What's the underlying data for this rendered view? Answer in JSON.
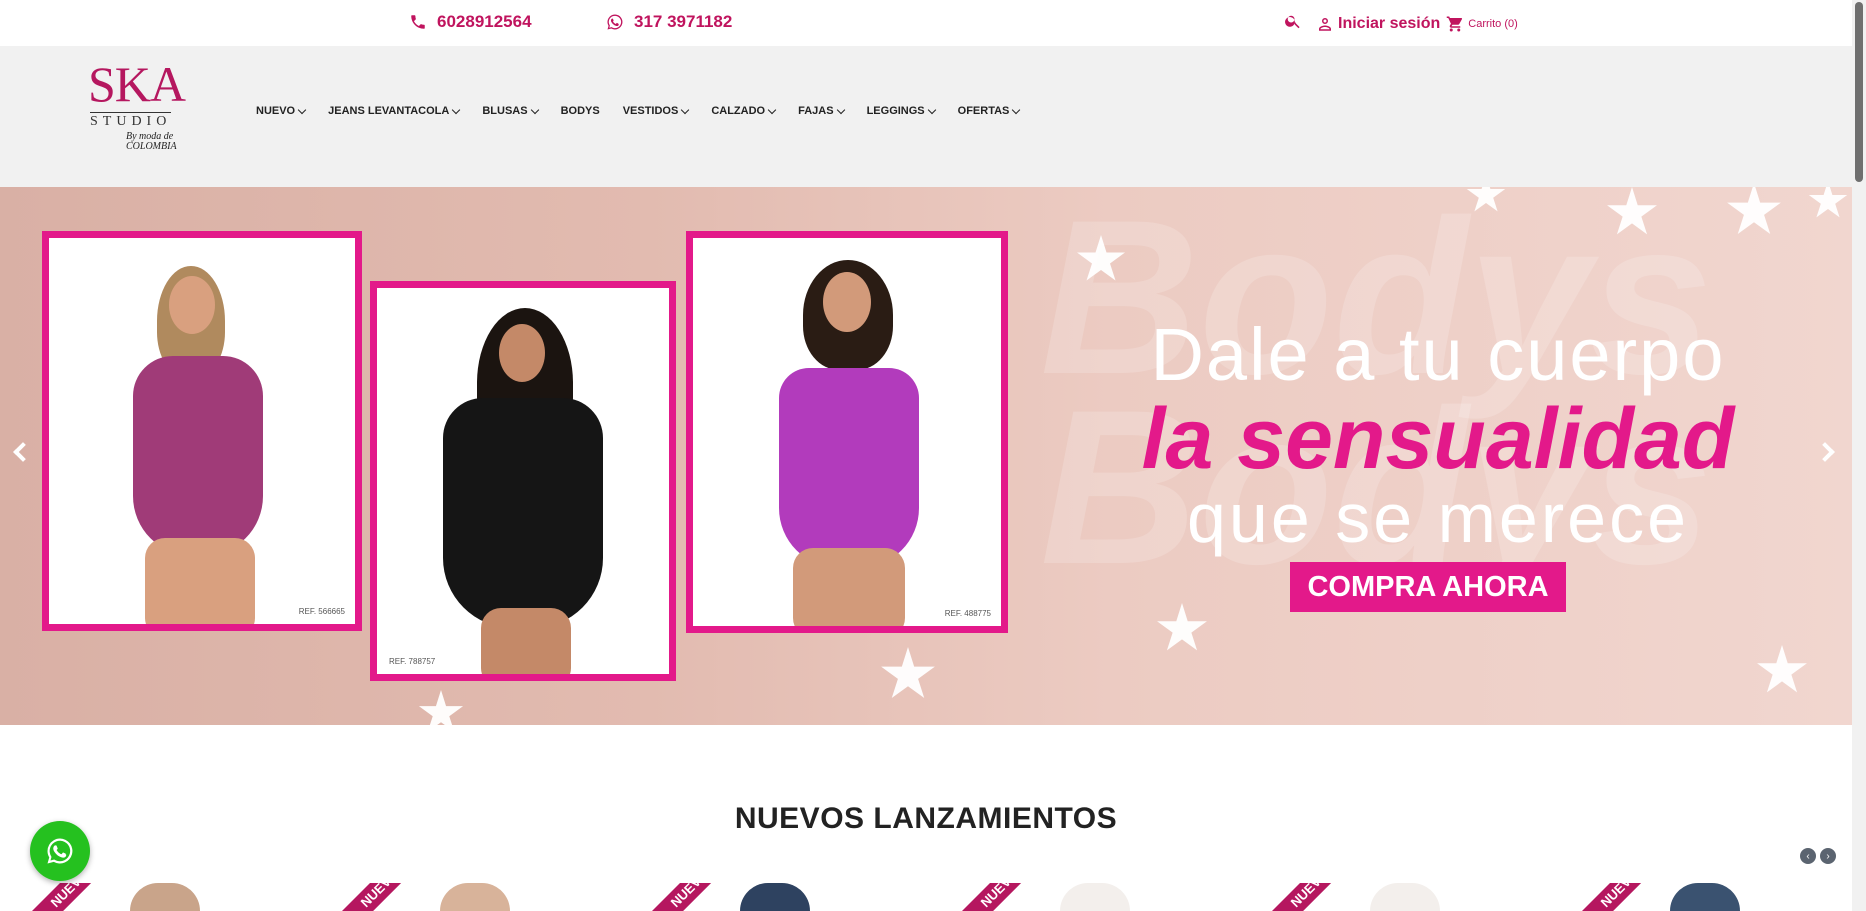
{
  "topbar": {
    "phone": "6028912564",
    "whatsapp": "317 3971182",
    "login_label": "Iniciar sesión",
    "cart_label": "Carrito (0)"
  },
  "brand": {
    "logo_main": "SKA",
    "logo_sub": "STUDIO",
    "logo_by": "By moda de COLOMBIA"
  },
  "nav": [
    {
      "label": "NUEVO",
      "dropdown": true
    },
    {
      "label": "JEANS LEVANTACOLA",
      "dropdown": true
    },
    {
      "label": "BLUSAS",
      "dropdown": true
    },
    {
      "label": "BODYS",
      "dropdown": false
    },
    {
      "label": "VESTIDOS",
      "dropdown": true
    },
    {
      "label": "CALZADO",
      "dropdown": true
    },
    {
      "label": "FAJAS",
      "dropdown": true
    },
    {
      "label": "LEGGINGS",
      "dropdown": true
    },
    {
      "label": "OFERTAS",
      "dropdown": true
    }
  ],
  "hero": {
    "line1": "Dale a tu cuerpo",
    "line2": "la sensualidad",
    "line3": "que se merece",
    "cta": "COMPRA AHORA",
    "watermark1": "Bodys",
    "watermark2": "Bodys",
    "refs": [
      "REF. 566665",
      "REF. 788757",
      "REF. 488775"
    ],
    "accent_color": "#e3198a"
  },
  "section": {
    "title": "NUEVOS LANZAMIENTOS",
    "badge": "NUEVO"
  },
  "colors": {
    "brand": "#c0145e",
    "hero_accent": "#e3198a",
    "whatsapp": "#25c11f"
  }
}
